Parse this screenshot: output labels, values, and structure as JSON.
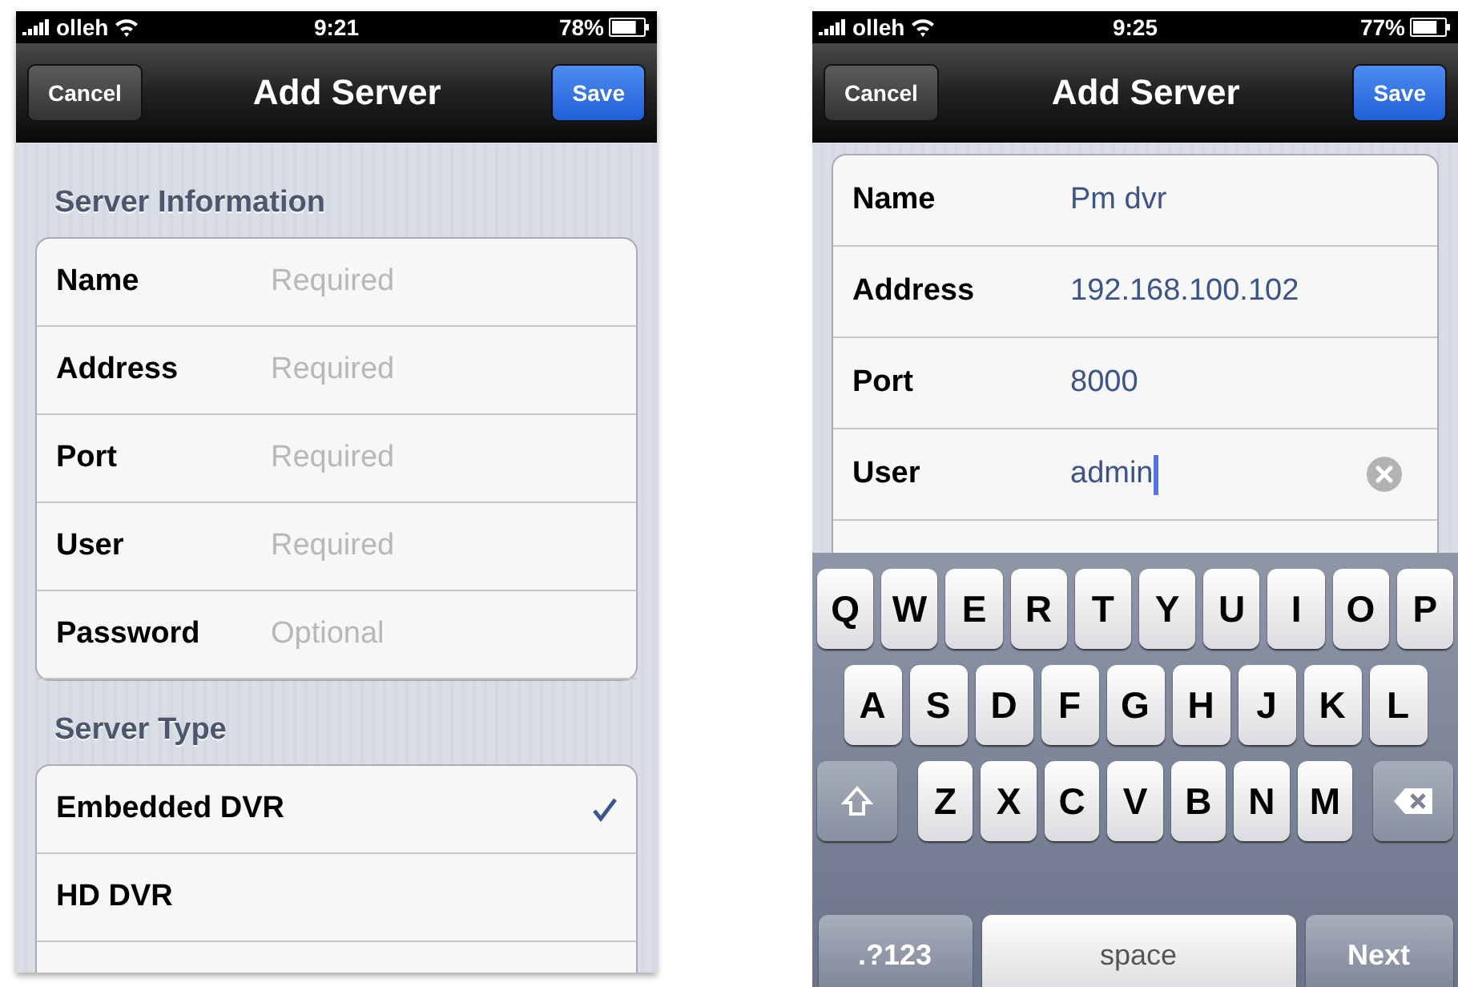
{
  "screens": [
    {
      "status_bar": {
        "carrier": "olleh",
        "time": "9:21",
        "battery": "78%"
      },
      "nav_bar": {
        "cancel": "Cancel",
        "title": "Add Server",
        "save": "Save"
      },
      "sections": [
        {
          "header": "Server Information",
          "rows": [
            {
              "kind": "field",
              "label": "Name",
              "placeholder": "Required"
            },
            {
              "kind": "field",
              "label": "Address",
              "placeholder": "Required"
            },
            {
              "kind": "field",
              "label": "Port",
              "placeholder": "Required"
            },
            {
              "kind": "field",
              "label": "User",
              "placeholder": "Required"
            },
            {
              "kind": "field",
              "label": "Password",
              "placeholder": "Optional"
            }
          ]
        },
        {
          "header": "Server Type",
          "rows": [
            {
              "kind": "option",
              "label": "Embedded DVR",
              "selected": true
            },
            {
              "kind": "option",
              "label": "HD DVR",
              "selected": false
            }
          ]
        }
      ]
    },
    {
      "status_bar": {
        "carrier": "olleh",
        "time": "9:25",
        "battery": "77%"
      },
      "nav_bar": {
        "cancel": "Cancel",
        "title": "Add Server",
        "save": "Save"
      },
      "sections": [
        {
          "rows": [
            {
              "kind": "field",
              "label": "Name",
              "value": "Pm dvr",
              "focused": false
            },
            {
              "kind": "field",
              "label": "Address",
              "value": "192.168.100.102",
              "focused": false
            },
            {
              "kind": "field",
              "label": "Port",
              "value": "8000",
              "focused": false
            },
            {
              "kind": "field",
              "label": "User",
              "value": "admin",
              "focused": true
            }
          ]
        }
      ],
      "keyboard": {
        "rows": [
          {
            "keys": [
              {
                "kind": "letter",
                "label": "Q"
              },
              {
                "kind": "letter",
                "label": "W"
              },
              {
                "kind": "letter",
                "label": "E"
              },
              {
                "kind": "letter",
                "label": "R"
              },
              {
                "kind": "letter",
                "label": "T"
              },
              {
                "kind": "letter",
                "label": "Y"
              },
              {
                "kind": "letter",
                "label": "U"
              },
              {
                "kind": "letter",
                "label": "I"
              },
              {
                "kind": "letter",
                "label": "O"
              },
              {
                "kind": "letter",
                "label": "P"
              }
            ]
          },
          {
            "keys": [
              {
                "kind": "letter",
                "label": "A"
              },
              {
                "kind": "letter",
                "label": "S"
              },
              {
                "kind": "letter",
                "label": "D"
              },
              {
                "kind": "letter",
                "label": "F"
              },
              {
                "kind": "letter",
                "label": "G"
              },
              {
                "kind": "letter",
                "label": "H"
              },
              {
                "kind": "letter",
                "label": "J"
              },
              {
                "kind": "letter",
                "label": "K"
              },
              {
                "kind": "letter",
                "label": "L"
              }
            ]
          },
          {
            "keys": [
              {
                "kind": "shift"
              },
              {
                "kind": "letter",
                "label": "Z"
              },
              {
                "kind": "letter",
                "label": "X"
              },
              {
                "kind": "letter",
                "label": "C"
              },
              {
                "kind": "letter",
                "label": "V"
              },
              {
                "kind": "letter",
                "label": "B"
              },
              {
                "kind": "letter",
                "label": "N"
              },
              {
                "kind": "letter",
                "label": "M"
              },
              {
                "kind": "backspace"
              }
            ]
          },
          {
            "keys": [
              {
                "kind": "mode",
                "label": ".?123"
              },
              {
                "kind": "space",
                "label": "space"
              },
              {
                "kind": "return",
                "label": "Next"
              }
            ]
          }
        ]
      }
    }
  ]
}
